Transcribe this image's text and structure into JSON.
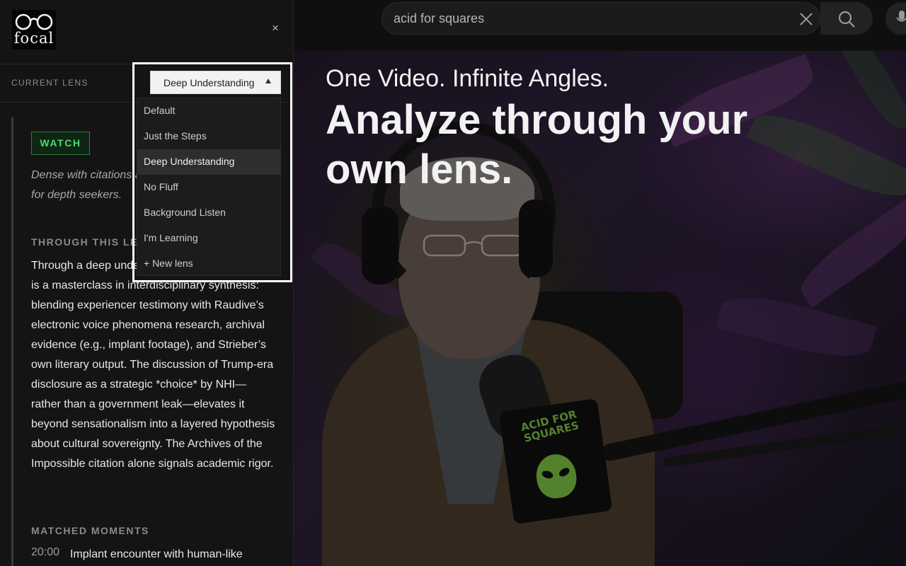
{
  "app": {
    "logo_text": "focal",
    "close_label": "×"
  },
  "lens": {
    "label": "CURRENT LENS",
    "selected": "Deep Understanding",
    "options": [
      "Default",
      "Just the Steps",
      "Deep Understanding",
      "No Fluff",
      "Background Listen",
      "I'm Learning",
      "+ New lens"
    ]
  },
  "analysis": {
    "verdict": "WATCH",
    "description": "Dense with citations and nuanced claims—ideal for depth seekers.",
    "through_heading": "THROUGH THIS LENS",
    "through_text": "Through a deep understanding lens, this video is a masterclass in interdisciplinary synthesis: blending experiencer testimony with Raudive’s electronic voice phenomena research, archival evidence (e.g., implant footage), and Strieber’s own literary output. The discussion of Trump-era disclosure as a strategic *choice* by NHI—rather than a government leak—elevates it beyond sensationalism into a layered hypothesis about cultural sovereignty. The Archives of the Impossible citation alone signals academic rigor.",
    "moments_heading": "MATCHED MOMENTS",
    "moments": [
      {
        "time": "20:00",
        "text": "Implant encounter with human-like figures"
      }
    ]
  },
  "search": {
    "value": "acid for squares",
    "icon_clear": "close-icon",
    "icon_search": "search-icon",
    "icon_mic": "mic-icon"
  },
  "hero": {
    "subtitle": "One Video. Infinite Angles.",
    "title": "Analyze through your own lens."
  },
  "video": {
    "mic_cube_text": "ACID FOR SQUARES"
  },
  "colors": {
    "accent_green": "#4cd96a",
    "sidebar_bg": "#141414",
    "highlight_frame": "#ffffff"
  }
}
